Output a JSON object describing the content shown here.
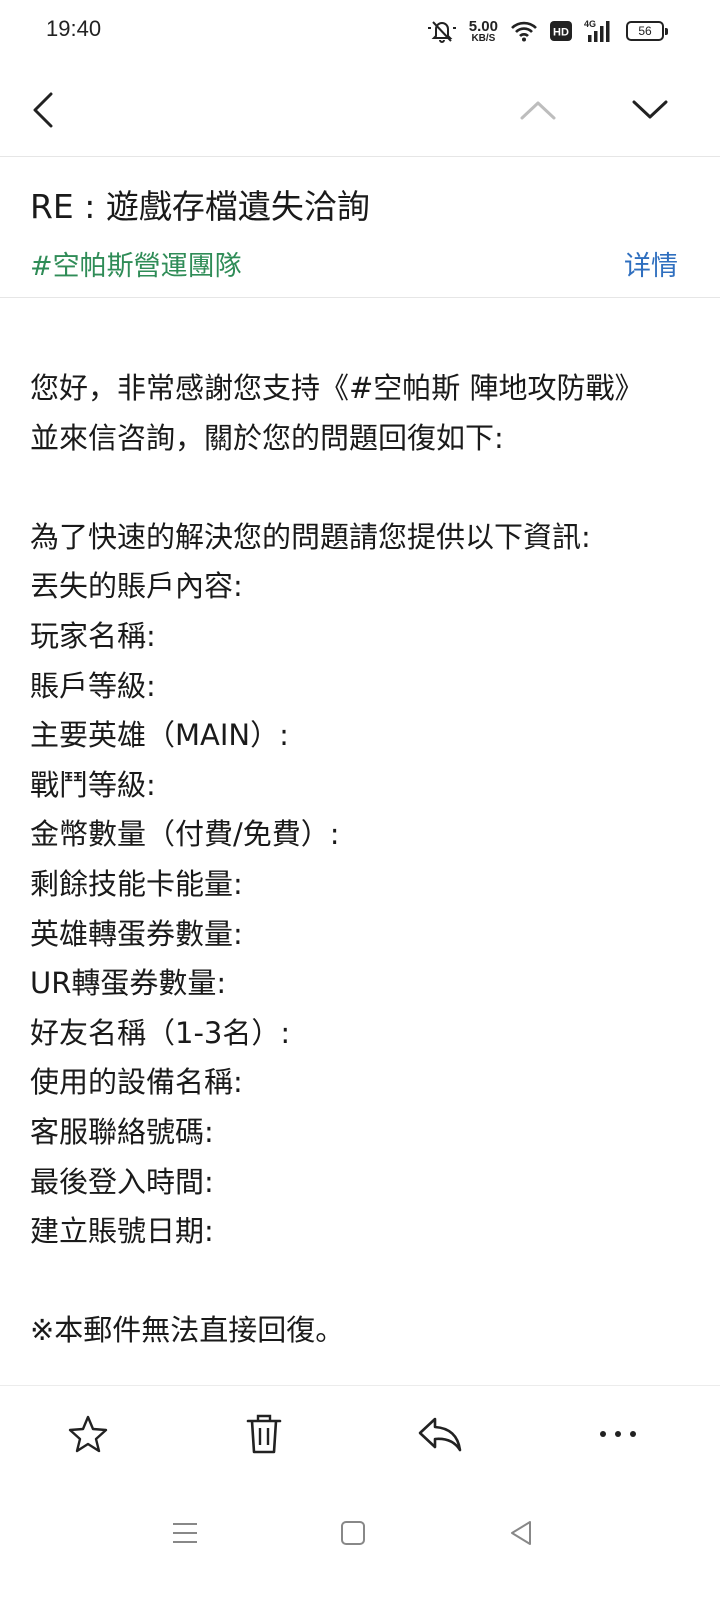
{
  "status_bar": {
    "time": "19:40",
    "net_speed_value": "5.00",
    "net_speed_unit": "KB/S",
    "hd_label": "HD",
    "network_type": "4G",
    "battery_level": "56",
    "icons": [
      "mute-bell-icon",
      "wifi-icon",
      "hd-icon",
      "signal-icon",
      "battery-icon"
    ]
  },
  "nav": {
    "icons": [
      "back-arrow-icon",
      "chevron-up-icon",
      "chevron-down-icon"
    ]
  },
  "email": {
    "subject": "RE : 遊戲存檔遺失洽詢",
    "sender": "#空帕斯營運團隊",
    "details_label": "详情",
    "intro": "您好，非常感謝您支持《#空帕斯 陣地攻防戰》並來信咨詢，關於您的問題回復如下:",
    "request": "為了快速的解決您的問題請您提供以下資訊:",
    "fields": [
      "丟失的賬戶內容:",
      "玩家名稱:",
      "賬戶等級:",
      "主要英雄（MAIN）:",
      "戰鬥等級:",
      "金幣數量（付費/免費）:",
      "剩餘技能卡能量:",
      "英雄轉蛋券數量:",
      "UR轉蛋券數量:",
      "好友名稱（1-3名）:",
      "使用的設備名稱:",
      "客服聯絡號碼:",
      "最後登入時間:",
      "建立賬號日期:"
    ],
    "footer_note": "※本郵件無法直接回復。"
  },
  "toolbar": {
    "icons": [
      "star-icon",
      "trash-icon",
      "reply-icon",
      "more-icon"
    ]
  },
  "system_nav": {
    "icons": [
      "menu-icon",
      "home-icon",
      "back-triangle-icon"
    ]
  },
  "colors": {
    "sender": "#2f8c57",
    "link": "#2f6fbf",
    "text": "#1a1a1a",
    "disabled": "#bdbdbd"
  }
}
